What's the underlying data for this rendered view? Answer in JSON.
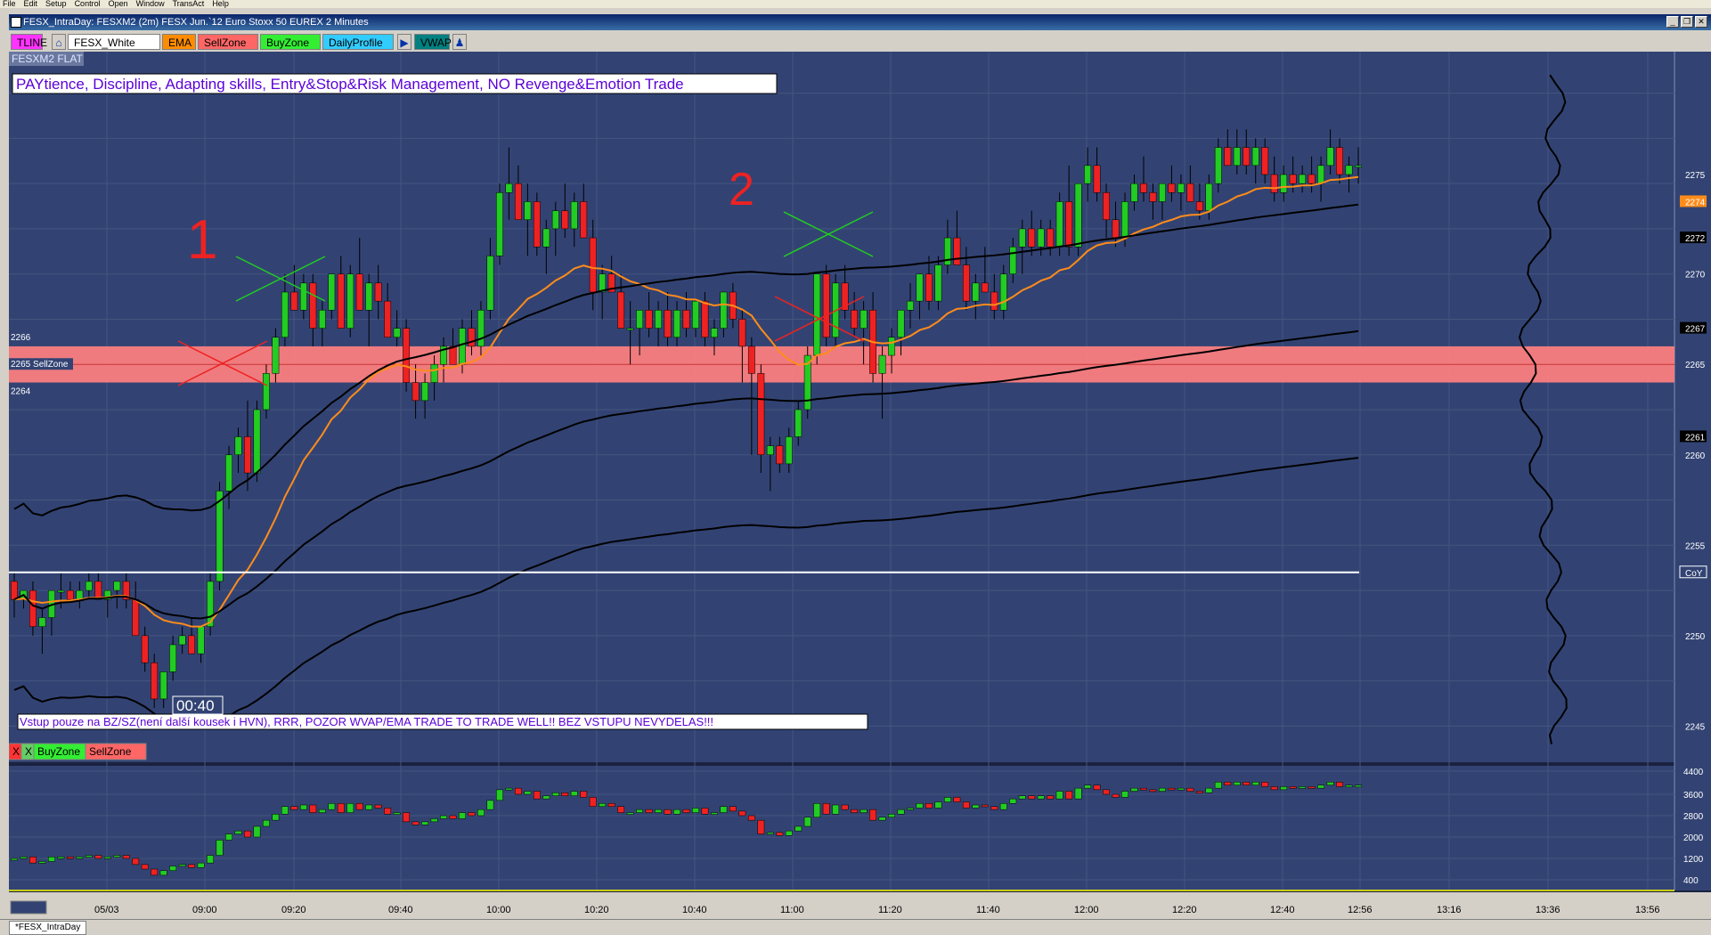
{
  "menu": [
    "File",
    "Edit",
    "Setup",
    "Control",
    "Open",
    "Window",
    "TransAct",
    "Help"
  ],
  "window_title": "FESX_IntraDay: FESXM2 (2m) FESX Jun.`12 Euro Stoxx 50 EUREX 2 Minutes",
  "toolbar": {
    "buttons": [
      {
        "label": "TLINE",
        "bg": "#ff33ff",
        "fg": "#000000"
      },
      {
        "label": "FESX_White",
        "bg": "#ffffff",
        "fg": "#000000"
      },
      {
        "label": "EMA",
        "bg": "#ff8c00",
        "fg": "#000000"
      },
      {
        "label": "SellZone",
        "bg": "#ff6666",
        "fg": "#000000"
      },
      {
        "label": "BuyZone",
        "bg": "#33ee33",
        "fg": "#000000"
      },
      {
        "label": "DailyProfile",
        "bg": "#33ccff",
        "fg": "#000000"
      },
      {
        "label": "VWAP",
        "bg": "#008080",
        "fg": "#000000"
      }
    ]
  },
  "chart": {
    "symbol_label": "FESXM2 FLAT",
    "top_note": "PAYtience, Discipline, Adapting skills, Entry&Stop&Risk Management, NO Revenge&Emotion Trade",
    "bottom_note": "Vstup pouze na BZ/SZ(není další kousek i HVN), RRR, POZOR WVAP/EMA TRADE TO TRADE WELL!! BEZ VSTUPU NEVYDELAS!!!",
    "time_box": "00:40",
    "zone_labels": [
      "2266",
      "2265 SellZone",
      "2264"
    ],
    "lower_buttons": [
      {
        "label": "X",
        "bg": "#ff3333"
      },
      {
        "label": "X",
        "bg": "#66cc66"
      },
      {
        "label": "BuyZone",
        "bg": "#33ee33"
      },
      {
        "label": "SellZone",
        "bg": "#ff6666"
      }
    ],
    "annotations": [
      "1",
      "2"
    ],
    "price_axis": [
      "2275",
      "2274",
      "2272",
      "2270",
      "2267",
      "2265",
      "2261",
      "2260",
      "2255",
      "CoY",
      "2250",
      "2245"
    ],
    "volume_axis": [
      "4400",
      "3600",
      "2800",
      "2000",
      "1200",
      "400"
    ],
    "time_axis": [
      "05/03",
      "09:00",
      "09:20",
      "09:40",
      "10:00",
      "10:20",
      "10:40",
      "11:00",
      "11:20",
      "11:40",
      "12:00",
      "12:20",
      "12:40",
      "12:56",
      "13:16",
      "13:36",
      "13:56"
    ],
    "colors": {
      "background": "#324373",
      "up": "#22cc22",
      "down": "#ee2222",
      "ema": "#ff8c1a",
      "sellzone": "#ff8080",
      "grid": "#44557f"
    }
  },
  "chart_data": {
    "type": "candlestick",
    "instrument": "FESXM2 (2m)",
    "ylim": [
      2243,
      2282
    ],
    "ohlc": [
      [
        2253.0,
        2253.5,
        2251.0,
        2252.0
      ],
      [
        2252.0,
        2252.5,
        2251.5,
        2252.5
      ],
      [
        2252.5,
        2253.0,
        2250.0,
        2250.5
      ],
      [
        2250.5,
        2251.5,
        2249.0,
        2251.0
      ],
      [
        2251.0,
        2252.5,
        2250.0,
        2252.5
      ],
      [
        2252.5,
        2253.5,
        2251.5,
        2252.5
      ],
      [
        2252.5,
        2253.0,
        2252.0,
        2252.0
      ],
      [
        2252.0,
        2253.0,
        2251.5,
        2252.5
      ],
      [
        2252.5,
        2253.5,
        2252.0,
        2253.0
      ],
      [
        2253.0,
        2253.5,
        2252.0,
        2252.0
      ],
      [
        2252.0,
        2252.5,
        2251.0,
        2252.5
      ],
      [
        2252.5,
        2253.0,
        2251.5,
        2253.0
      ],
      [
        2253.0,
        2253.5,
        2251.5,
        2252.0
      ],
      [
        2252.0,
        2253.0,
        2250.0,
        2250.0
      ],
      [
        2250.0,
        2250.5,
        2248.0,
        2248.5
      ],
      [
        2248.5,
        2249.0,
        2246.0,
        2246.5
      ],
      [
        2246.5,
        2248.0,
        2246.0,
        2248.0
      ],
      [
        2248.0,
        2250.0,
        2247.5,
        2249.5
      ],
      [
        2249.5,
        2250.5,
        2249.0,
        2250.0
      ],
      [
        2250.0,
        2251.0,
        2249.0,
        2249.0
      ],
      [
        2249.0,
        2250.5,
        2248.5,
        2250.5
      ],
      [
        2250.5,
        2253.5,
        2250.0,
        2253.0
      ],
      [
        2253.0,
        2258.5,
        2252.5,
        2258.0
      ],
      [
        2258.0,
        2260.5,
        2257.0,
        2260.0
      ],
      [
        2260.0,
        2261.5,
        2259.0,
        2261.0
      ],
      [
        2261.0,
        2263.0,
        2258.0,
        2259.0
      ],
      [
        2259.0,
        2263.0,
        2258.5,
        2262.5
      ],
      [
        2262.5,
        2265.0,
        2262.0,
        2264.5
      ],
      [
        2264.5,
        2267.0,
        2264.0,
        2266.5
      ],
      [
        2266.5,
        2270.0,
        2266.0,
        2269.0
      ],
      [
        2269.0,
        2270.5,
        2268.0,
        2268.0
      ],
      [
        2268.0,
        2270.0,
        2267.5,
        2269.5
      ],
      [
        2269.5,
        2270.0,
        2266.0,
        2267.0
      ],
      [
        2267.0,
        2268.5,
        2266.0,
        2268.0
      ],
      [
        2268.0,
        2270.0,
        2267.5,
        2270.0
      ],
      [
        2270.0,
        2271.0,
        2267.0,
        2267.0
      ],
      [
        2267.0,
        2270.5,
        2266.5,
        2270.0
      ],
      [
        2270.0,
        2272.0,
        2268.0,
        2268.0
      ],
      [
        2268.0,
        2270.0,
        2266.0,
        2269.5
      ],
      [
        2269.5,
        2270.5,
        2267.5,
        2268.5
      ],
      [
        2268.5,
        2269.5,
        2266.5,
        2266.5
      ],
      [
        2266.5,
        2268.0,
        2266.0,
        2267.0
      ],
      [
        2267.0,
        2267.5,
        2263.5,
        2264.0
      ],
      [
        2264.0,
        2265.0,
        2262.0,
        2263.0
      ],
      [
        2263.0,
        2264.5,
        2262.0,
        2264.0
      ],
      [
        2264.0,
        2265.5,
        2263.0,
        2265.0
      ],
      [
        2265.0,
        2266.5,
        2264.0,
        2266.0
      ],
      [
        2266.0,
        2267.0,
        2265.0,
        2265.0
      ],
      [
        2265.0,
        2267.5,
        2264.5,
        2267.0
      ],
      [
        2267.0,
        2268.0,
        2265.5,
        2266.0
      ],
      [
        2266.0,
        2268.5,
        2265.5,
        2268.0
      ],
      [
        2268.0,
        2272.0,
        2267.5,
        2271.0
      ],
      [
        2271.0,
        2275.0,
        2270.5,
        2274.5
      ],
      [
        2274.5,
        2277.0,
        2273.0,
        2275.0
      ],
      [
        2275.0,
        2276.0,
        2273.0,
        2273.0
      ],
      [
        2273.0,
        2275.0,
        2271.0,
        2274.0
      ],
      [
        2274.0,
        2274.5,
        2271.0,
        2271.5
      ],
      [
        2271.5,
        2273.0,
        2270.0,
        2272.5
      ],
      [
        2272.5,
        2274.0,
        2271.0,
        2273.5
      ],
      [
        2273.5,
        2275.0,
        2272.0,
        2272.5
      ],
      [
        2272.5,
        2274.5,
        2271.5,
        2274.0
      ],
      [
        2274.0,
        2275.0,
        2272.0,
        2272.0
      ],
      [
        2272.0,
        2273.0,
        2268.0,
        2269.0
      ],
      [
        2269.0,
        2270.5,
        2267.5,
        2270.0
      ],
      [
        2270.0,
        2271.0,
        2269.0,
        2269.0
      ],
      [
        2269.0,
        2270.0,
        2267.0,
        2267.0
      ],
      [
        2267.0,
        2268.5,
        2265.0,
        2267.0
      ],
      [
        2267.0,
        2268.0,
        2265.5,
        2268.0
      ],
      [
        2268.0,
        2269.0,
        2266.5,
        2267.0
      ],
      [
        2267.0,
        2268.5,
        2266.0,
        2268.0
      ],
      [
        2268.0,
        2269.0,
        2266.0,
        2266.5
      ],
      [
        2266.5,
        2268.5,
        2266.0,
        2268.0
      ],
      [
        2268.0,
        2269.0,
        2266.5,
        2267.0
      ],
      [
        2267.0,
        2268.5,
        2266.5,
        2268.5
      ],
      [
        2268.5,
        2269.0,
        2266.0,
        2266.5
      ],
      [
        2266.5,
        2267.5,
        2265.5,
        2267.0
      ],
      [
        2267.0,
        2269.0,
        2266.5,
        2269.0
      ],
      [
        2269.0,
        2269.5,
        2267.0,
        2267.5
      ],
      [
        2267.5,
        2268.0,
        2264.0,
        2266.0
      ],
      [
        2266.0,
        2266.5,
        2260.0,
        2264.5
      ],
      [
        2264.5,
        2265.0,
        2259.0,
        2260.0
      ],
      [
        2260.0,
        2261.0,
        2258.0,
        2260.5
      ],
      [
        2260.5,
        2261.0,
        2259.0,
        2259.5
      ],
      [
        2259.5,
        2261.5,
        2259.0,
        2261.0
      ],
      [
        2261.0,
        2263.0,
        2260.5,
        2262.5
      ],
      [
        2262.5,
        2266.0,
        2262.0,
        2265.5
      ],
      [
        2265.5,
        2270.0,
        2265.0,
        2270.0
      ],
      [
        2270.0,
        2270.5,
        2266.0,
        2266.5
      ],
      [
        2266.5,
        2270.0,
        2266.0,
        2269.5
      ],
      [
        2269.5,
        2270.5,
        2267.5,
        2268.0
      ],
      [
        2268.0,
        2269.0,
        2266.5,
        2267.0
      ],
      [
        2267.0,
        2268.5,
        2265.0,
        2268.0
      ],
      [
        2268.0,
        2269.0,
        2264.0,
        2264.5
      ],
      [
        2264.5,
        2266.0,
        2262.0,
        2265.5
      ],
      [
        2265.5,
        2267.0,
        2264.5,
        2266.5
      ],
      [
        2266.5,
        2268.0,
        2265.5,
        2268.0
      ],
      [
        2268.0,
        2269.5,
        2267.0,
        2268.5
      ],
      [
        2268.5,
        2270.0,
        2267.5,
        2270.0
      ],
      [
        2270.0,
        2271.0,
        2268.0,
        2268.5
      ],
      [
        2268.5,
        2271.0,
        2268.0,
        2270.5
      ],
      [
        2270.5,
        2273.0,
        2270.0,
        2272.0
      ],
      [
        2272.0,
        2273.5,
        2270.5,
        2270.5
      ],
      [
        2270.5,
        2271.5,
        2268.0,
        2268.5
      ],
      [
        2268.5,
        2270.0,
        2267.5,
        2269.5
      ],
      [
        2269.5,
        2271.5,
        2269.0,
        2269.0
      ],
      [
        2269.0,
        2270.0,
        2267.5,
        2268.0
      ],
      [
        2268.0,
        2270.5,
        2267.5,
        2270.0
      ],
      [
        2270.0,
        2272.0,
        2269.5,
        2271.5
      ],
      [
        2271.5,
        2273.0,
        2270.0,
        2272.5
      ],
      [
        2272.5,
        2273.5,
        2271.0,
        2271.5
      ],
      [
        2271.5,
        2273.0,
        2271.0,
        2272.5
      ],
      [
        2272.5,
        2273.0,
        2271.0,
        2271.5
      ],
      [
        2271.5,
        2274.5,
        2271.0,
        2274.0
      ],
      [
        2274.0,
        2276.0,
        2271.0,
        2271.5
      ],
      [
        2271.5,
        2275.0,
        2271.0,
        2275.0
      ],
      [
        2275.0,
        2277.0,
        2274.0,
        2276.0
      ],
      [
        2276.0,
        2277.0,
        2274.0,
        2274.5
      ],
      [
        2274.5,
        2275.0,
        2272.0,
        2273.0
      ],
      [
        2273.0,
        2274.0,
        2271.5,
        2272.0
      ],
      [
        2272.0,
        2274.5,
        2271.5,
        2274.0
      ],
      [
        2274.0,
        2275.5,
        2273.5,
        2275.0
      ],
      [
        2275.0,
        2276.5,
        2274.0,
        2274.5
      ],
      [
        2274.5,
        2275.0,
        2273.0,
        2274.0
      ],
      [
        2274.0,
        2275.0,
        2273.0,
        2275.0
      ],
      [
        2275.0,
        2276.0,
        2274.0,
        2274.5
      ],
      [
        2274.5,
        2275.5,
        2273.5,
        2275.0
      ],
      [
        2275.0,
        2276.0,
        2274.0,
        2274.0
      ],
      [
        2274.0,
        2275.0,
        2273.0,
        2273.5
      ],
      [
        2273.5,
        2275.5,
        2273.0,
        2275.0
      ],
      [
        2275.0,
        2277.5,
        2274.5,
        2277.0
      ],
      [
        2277.0,
        2278.0,
        2276.0,
        2276.0
      ],
      [
        2276.0,
        2278.0,
        2275.5,
        2277.0
      ],
      [
        2277.0,
        2278.0,
        2275.5,
        2276.0
      ],
      [
        2276.0,
        2277.5,
        2275.0,
        2277.0
      ],
      [
        2277.0,
        2277.5,
        2275.0,
        2275.5
      ],
      [
        2275.5,
        2276.5,
        2274.0,
        2274.5
      ],
      [
        2274.5,
        2276.0,
        2274.0,
        2275.5
      ],
      [
        2275.5,
        2276.5,
        2274.5,
        2275.0
      ],
      [
        2275.0,
        2276.0,
        2274.5,
        2275.5
      ],
      [
        2275.5,
        2276.5,
        2274.5,
        2275.0
      ],
      [
        2275.0,
        2276.5,
        2274.0,
        2276.0
      ],
      [
        2276.0,
        2278.0,
        2275.5,
        2277.0
      ],
      [
        2277.0,
        2277.5,
        2275.0,
        2275.5
      ],
      [
        2275.5,
        2276.5,
        2274.5,
        2276.0
      ],
      [
        2276.0,
        2277.0,
        2275.0,
        2276.0
      ]
    ],
    "sellzone": [
      2264,
      2266
    ],
    "xlabel": "",
    "ylabel": ""
  }
}
